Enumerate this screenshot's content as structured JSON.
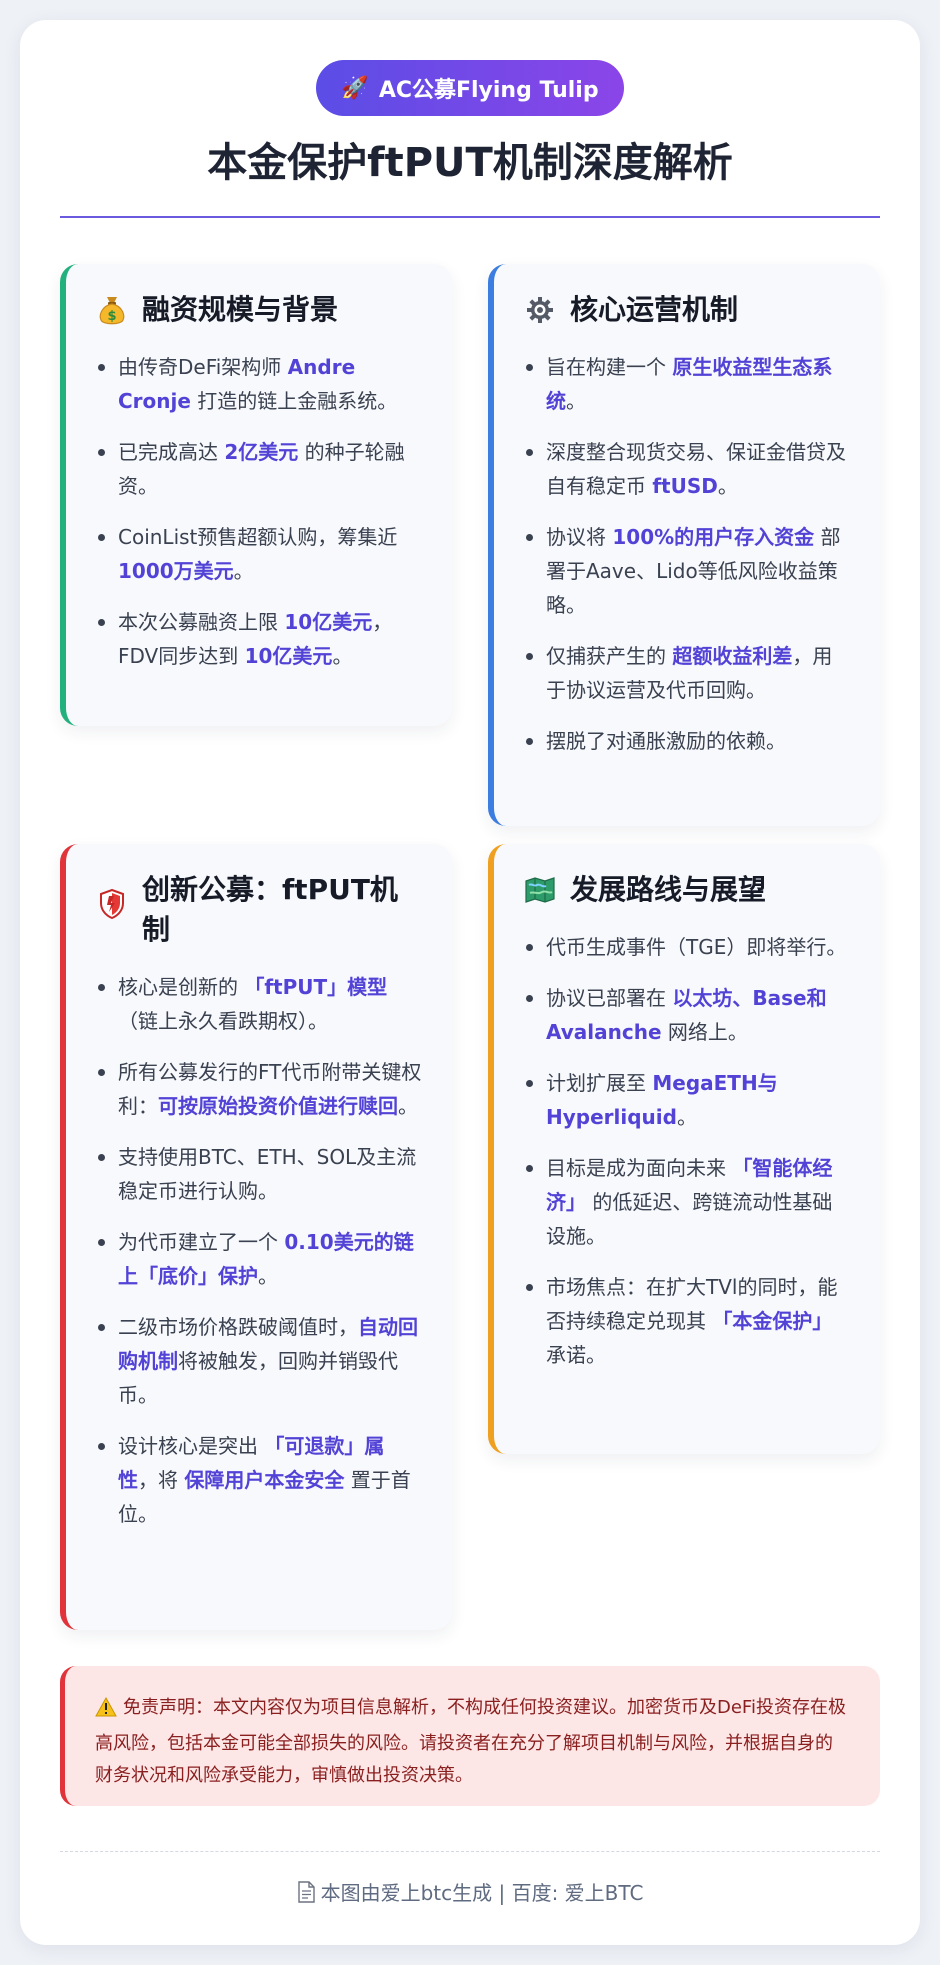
{
  "header": {
    "badge_icon": "rocket-icon",
    "badge_text": "AC公募Flying Tulip",
    "title": "本金保护ftPUT机制深度解析",
    "accent": "#6a5ae0"
  },
  "cards": [
    {
      "title": "融资规模与背景",
      "icon": "money-bag-icon",
      "border_color": "#22b07d",
      "items": [
        [
          {
            "t": "由传奇DeFi架构师 "
          },
          {
            "t": "Andre Cronje",
            "h": true
          },
          {
            "t": " 打造的链上金融系统。"
          }
        ],
        [
          {
            "t": "已完成高达 "
          },
          {
            "t": "2亿美元",
            "h": true
          },
          {
            "t": " 的种子轮融资。"
          }
        ],
        [
          {
            "t": "CoinList预售超额认购，筹集近 "
          },
          {
            "t": "1000万美元",
            "h": true
          },
          {
            "t": "。"
          }
        ],
        [
          {
            "t": "本次公募融资上限 "
          },
          {
            "t": "10亿美元",
            "h": true
          },
          {
            "t": "，FDV同步达到 "
          },
          {
            "t": "10亿美元",
            "h": true
          },
          {
            "t": "。"
          }
        ]
      ]
    },
    {
      "title": "核心运营机制",
      "icon": "gear-icon",
      "border_color": "#3b7de0",
      "items": [
        [
          {
            "t": "旨在构建一个 "
          },
          {
            "t": "原生收益型生态系统",
            "h": true
          },
          {
            "t": "。"
          }
        ],
        [
          {
            "t": "深度整合现货交易、保证金借贷及自有稳定币 "
          },
          {
            "t": "ftUSD",
            "h": true
          },
          {
            "t": "。"
          }
        ],
        [
          {
            "t": "协议将 "
          },
          {
            "t": "100%的用户存入资金",
            "h": true
          },
          {
            "t": " 部署于Aave、Lido等低风险收益策略。"
          }
        ],
        [
          {
            "t": "仅捕获产生的 "
          },
          {
            "t": "超额收益利差",
            "h": true
          },
          {
            "t": "，用于协议运营及代币回购。"
          }
        ],
        [
          {
            "t": "摆脱了对通胀激励的依赖。"
          }
        ]
      ]
    },
    {
      "title": "创新公募：ftPUT机制",
      "icon": "shield-icon",
      "border_color": "#e0333a",
      "items": [
        [
          {
            "t": "核心是创新的 "
          },
          {
            "t": "「ftPUT」模型",
            "h": true
          },
          {
            "t": "（链上永久看跌期权）。"
          }
        ],
        [
          {
            "t": "所有公募发行的FT代币附带关键权利："
          },
          {
            "t": "可按原始投资价值进行赎回",
            "h": true
          },
          {
            "t": "。"
          }
        ],
        [
          {
            "t": "支持使用BTC、ETH、SOL及主流稳定币进行认购。"
          }
        ],
        [
          {
            "t": "为代币建立了一个 "
          },
          {
            "t": "0.10美元的链上「底价」保护",
            "h": true
          },
          {
            "t": "。"
          }
        ],
        [
          {
            "t": "二级市场价格跌破阈值时，"
          },
          {
            "t": "自动回购机制",
            "h": true
          },
          {
            "t": "将被触发，回购并销毁代币。"
          }
        ],
        [
          {
            "t": "设计核心是突出 "
          },
          {
            "t": "「可退款」属性",
            "h": true
          },
          {
            "t": "，将 "
          },
          {
            "t": "保障用户本金安全",
            "h": true
          },
          {
            "t": " 置于首位。"
          }
        ]
      ]
    },
    {
      "title": "发展路线与展望",
      "icon": "map-icon",
      "border_color": "#f0a020",
      "items": [
        [
          {
            "t": "代币生成事件（TGE）即将举行。"
          }
        ],
        [
          {
            "t": "协议已部署在 "
          },
          {
            "t": "以太坊、Base和Avalanche",
            "h": true
          },
          {
            "t": " 网络上。"
          }
        ],
        [
          {
            "t": "计划扩展至 "
          },
          {
            "t": "MegaETH与Hyperliquid",
            "h": true
          },
          {
            "t": "。"
          }
        ],
        [
          {
            "t": "目标是成为面向未来 "
          },
          {
            "t": "「智能体经济」",
            "h": true
          },
          {
            "t": " 的低延迟、跨链流动性基础设施。"
          }
        ],
        [
          {
            "t": "市场焦点：在扩大TVl的同时，能否持续稳定兑现其 "
          },
          {
            "t": "「本金保护」",
            "h": true
          },
          {
            "t": " 承诺。"
          }
        ]
      ]
    }
  ],
  "disclaimer": {
    "icon": "warning-icon",
    "text": "免责声明：本文内容仅为项目信息解析，不构成任何投资建议。加密货币及DeFi投资存在极高风险，包括本金可能全部损失的风险。请投资者在充分了解项目机制与风险，并根据自身的财务状况和风险承受能力，审慎做出投资决策。"
  },
  "footer": {
    "icon": "document-icon",
    "text": "本图由爱上btc生成 | 百度: 爱上BTC"
  }
}
